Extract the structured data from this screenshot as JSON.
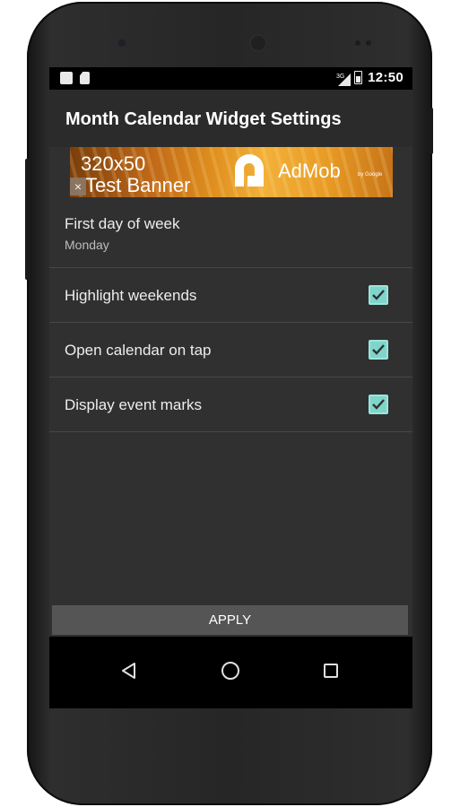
{
  "status_bar": {
    "time": "12:50",
    "network_label": "3G",
    "left_icons": [
      "notification-icon",
      "sd-card-icon"
    ],
    "right_icons": [
      "signal-icon",
      "battery-icon"
    ]
  },
  "app": {
    "title": "Month Calendar Widget Settings"
  },
  "ad_banner": {
    "size_text": "320x50",
    "label": "Test Banner",
    "close": "×",
    "brand": "AdMob",
    "brand_sub": "by Google",
    "colors": {
      "dark": "#7a3e0b",
      "mid": "#e0901f",
      "light": "#f2b13a"
    }
  },
  "preferences": [
    {
      "title": "First day of week",
      "summary": "Monday"
    },
    {
      "title": "Highlight weekends",
      "checked": true
    },
    {
      "title": "Open calendar on tap",
      "checked": true
    },
    {
      "title": "Display event marks",
      "checked": true
    }
  ],
  "apply_button": {
    "label": "APPLY"
  },
  "nav_bar": {
    "icons": [
      "back-icon",
      "home-icon",
      "recents-icon"
    ]
  },
  "colors": {
    "app_background": "#303030",
    "checkbox_accent": "#7fd5cb",
    "button_background": "#555555",
    "text_primary": "#ededed",
    "text_secondary": "#bdbdbd"
  }
}
